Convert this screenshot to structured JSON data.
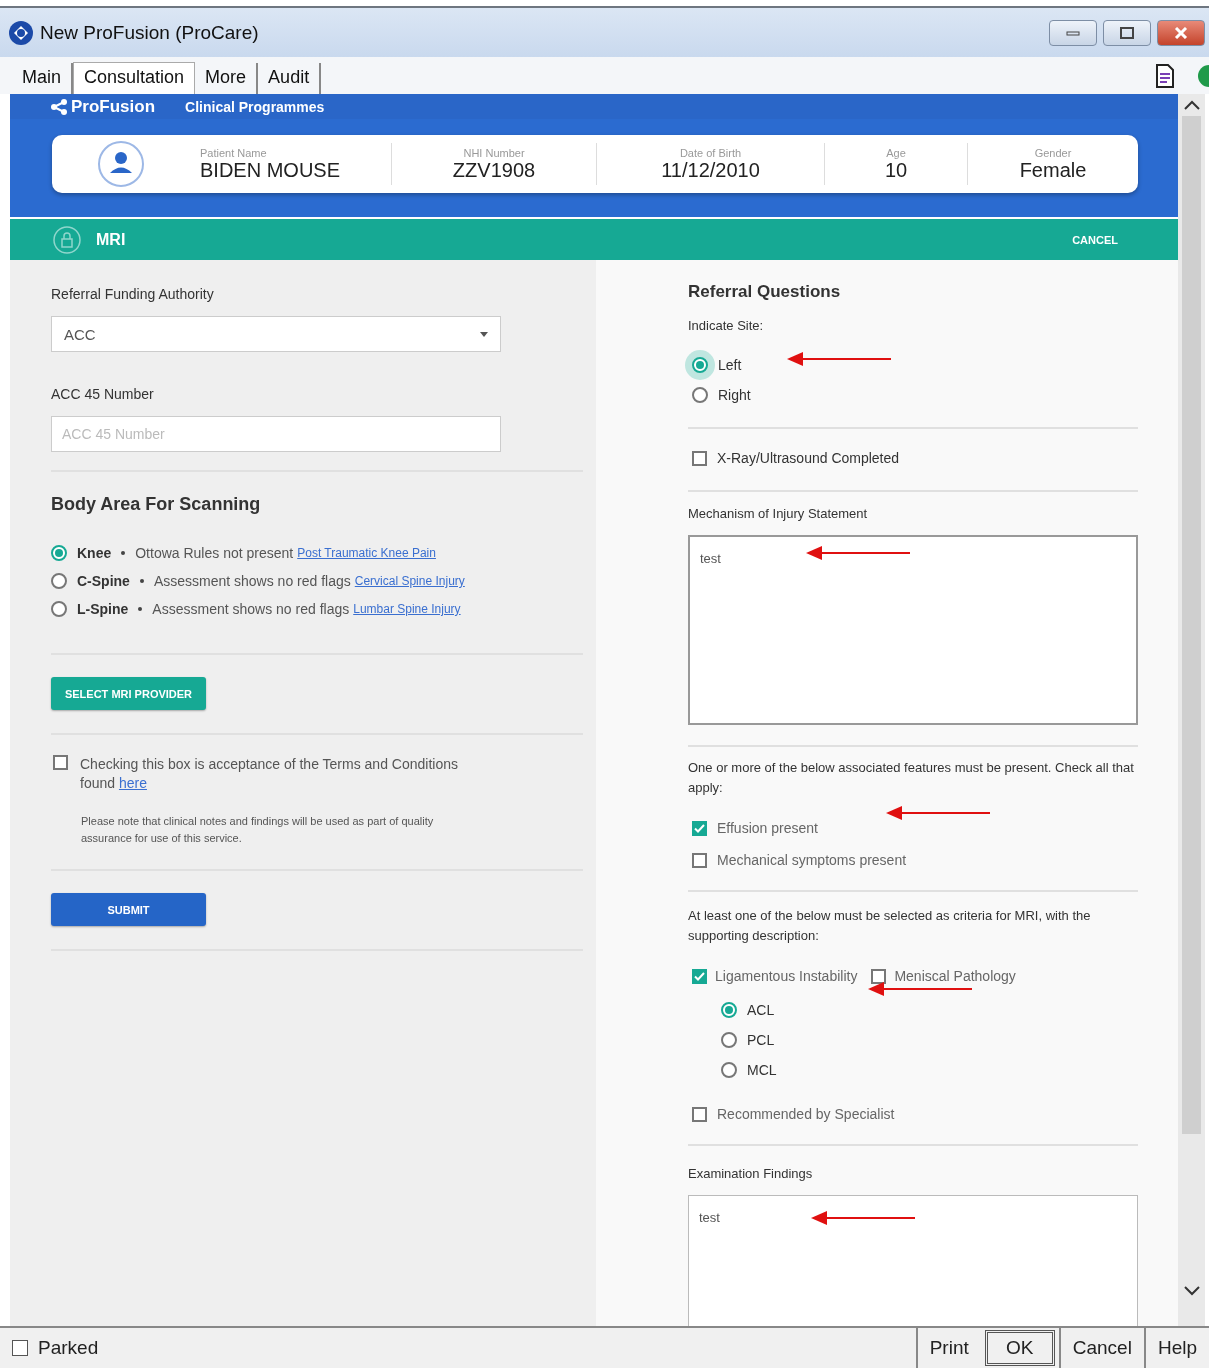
{
  "window": {
    "title": "New ProFusion (ProCare)"
  },
  "menu_tabs": [
    {
      "label": "Main",
      "selected": false
    },
    {
      "label": "Consultation",
      "selected": true
    },
    {
      "label": "More",
      "selected": false
    },
    {
      "label": "Audit",
      "selected": false
    }
  ],
  "nav": {
    "brand": "ProFusion",
    "link": "Clinical Programmes"
  },
  "patient": [
    {
      "label": "Patient Name",
      "value": "BIDEN MOUSE"
    },
    {
      "label": "NHI Number",
      "value": "ZZV1908"
    },
    {
      "label": "Date of Birth",
      "value": "11/12/2010"
    },
    {
      "label": "Age",
      "value": "10"
    },
    {
      "label": "Gender",
      "value": "Female"
    }
  ],
  "section_bar": {
    "title": "MRI",
    "action": "CANCEL"
  },
  "left": {
    "funding": {
      "label": "Referral Funding Authority",
      "value": "ACC"
    },
    "acc45": {
      "label": "ACC 45 Number",
      "placeholder": "ACC 45 Number"
    },
    "body_area": {
      "title": "Body Area For Scanning",
      "options": [
        {
          "label": "Knee",
          "note": "Ottowa Rules not present",
          "link": "Post Traumatic Knee Pain",
          "selected": true
        },
        {
          "label": "C-Spine",
          "note": "Assessment shows no red flags",
          "link": "Cervical Spine Injury",
          "selected": false
        },
        {
          "label": "L-Spine",
          "note": "Assessment shows no red flags",
          "link": "Lumbar Spine Injury",
          "selected": false
        }
      ]
    },
    "provider_button": "SELECT MRI PROVIDER",
    "terms": {
      "checked": false,
      "text": "Checking this box is acceptance of the Terms and Conditions found",
      "link": "here"
    },
    "note": "Please note that clinical notes and findings will be used as part of quality assurance for use of this service.",
    "submit_button": "SUBMIT"
  },
  "right": {
    "title": "Referral Questions",
    "site": {
      "label": "Indicate Site:",
      "options": [
        {
          "label": "Left",
          "selected": true
        },
        {
          "label": "Right",
          "selected": false
        }
      ]
    },
    "xray": {
      "label": "X-Ray/Ultrasound Completed",
      "checked": false
    },
    "mechanism": {
      "label": "Mechanism of Injury Statement",
      "value": "test"
    },
    "features": {
      "prompt": "One or more of the below associated features must be present. Check all that apply:",
      "items": [
        {
          "label": "Effusion present",
          "checked": true
        },
        {
          "label": "Mechanical symptoms present",
          "checked": false
        }
      ]
    },
    "criteria": {
      "prompt": "At least one of the below must be selected as criteria for MRI, with the supporting description:",
      "items": [
        {
          "label": "Ligamentous Instability",
          "checked": true
        },
        {
          "label": "Meniscal Pathology",
          "checked": false
        }
      ],
      "ligaments": [
        {
          "label": "ACL",
          "selected": true
        },
        {
          "label": "PCL",
          "selected": false
        },
        {
          "label": "MCL",
          "selected": false
        }
      ]
    },
    "specialist": {
      "label": "Recommended by Specialist",
      "checked": false
    },
    "findings": {
      "label": "Examination Findings",
      "value": "test"
    }
  },
  "status_bar": {
    "parked": {
      "label": "Parked",
      "checked": false
    },
    "buttons": [
      {
        "label": "Print",
        "default": false
      },
      {
        "label": "OK",
        "default": true
      },
      {
        "label": "Cancel",
        "default": false
      },
      {
        "label": "Help",
        "default": false
      }
    ]
  }
}
